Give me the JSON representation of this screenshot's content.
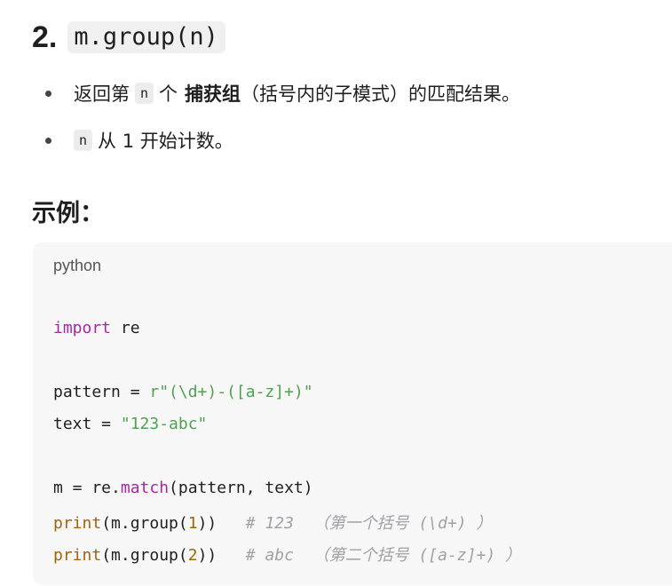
{
  "heading": {
    "number": "2.",
    "code": "m.group(n)"
  },
  "bullets": [
    {
      "before": "返回第",
      "code": "n",
      "middle": "个",
      "bold": "捕获组",
      "after": "（括号内的子模式）的匹配结果。"
    },
    {
      "code": "n",
      "after": "从 1 开始计数。"
    }
  ],
  "example_heading": "示例：",
  "code_block": {
    "language": "python",
    "line1": {
      "kw": "import",
      "rest": " re"
    },
    "line2": {
      "a": "pattern = ",
      "str": "r\"(\\d+)-([a-z]+)\""
    },
    "line3": {
      "a": "text = ",
      "str": "\"123-abc\""
    },
    "line4": {
      "a": "m = re.",
      "meth": "match",
      "b": "(pattern, text)"
    },
    "line5": {
      "fn": "print",
      "a": "(m.group(",
      "num": "1",
      "b": "))   ",
      "cmt": "# 123  （第一个括号 (\\d+) ）"
    },
    "line6": {
      "fn": "print",
      "a": "(m.group(",
      "num": "2",
      "b": "))   ",
      "cmt": "# abc  （第二个括号 ([a-z]+) ）"
    }
  }
}
